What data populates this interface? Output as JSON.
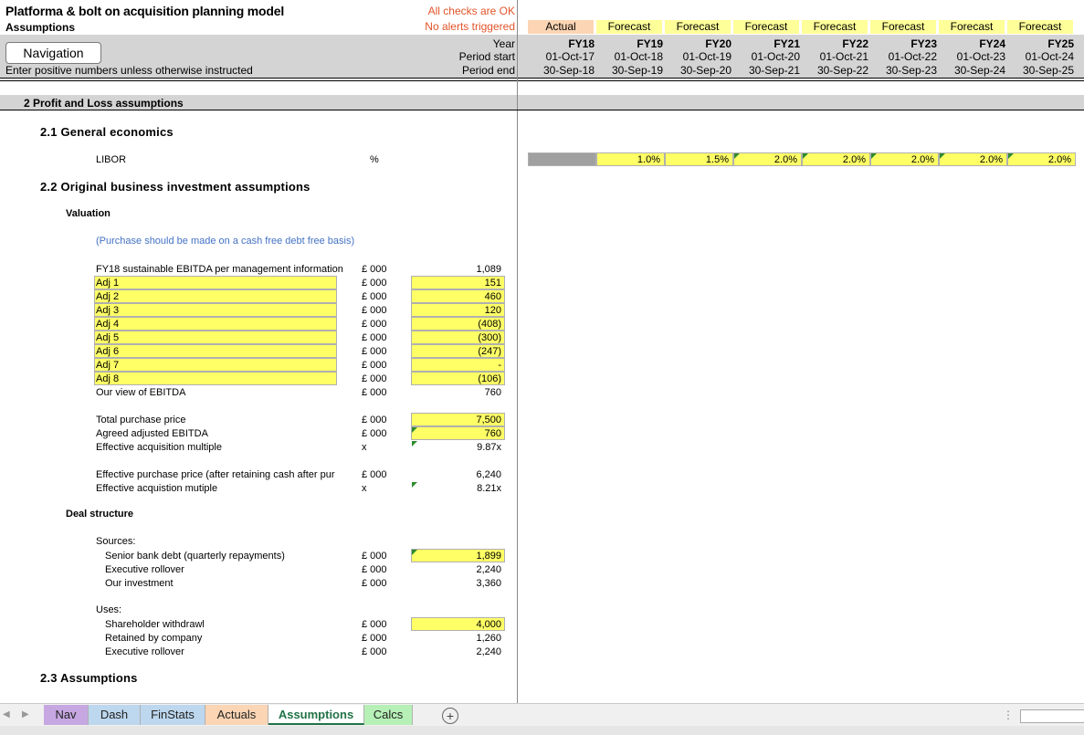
{
  "header": {
    "title": "Platforma & bolt on acquisition planning model",
    "subtitle": "Assumptions",
    "checks_ok": "All checks are OK",
    "alerts": "No alerts triggered",
    "nav_button": "Navigation",
    "instruction": "Enter positive numbers unless otherwise instructed",
    "row_year": "Year",
    "row_period_start": "Period start",
    "row_period_end": "Period end"
  },
  "columns": [
    {
      "type": "Actual",
      "year": "FY18",
      "start": "01-Oct-17",
      "end": "30-Sep-18"
    },
    {
      "type": "Forecast",
      "year": "FY19",
      "start": "01-Oct-18",
      "end": "30-Sep-19"
    },
    {
      "type": "Forecast",
      "year": "FY20",
      "start": "01-Oct-19",
      "end": "30-Sep-20"
    },
    {
      "type": "Forecast",
      "year": "FY21",
      "start": "01-Oct-20",
      "end": "30-Sep-21"
    },
    {
      "type": "Forecast",
      "year": "FY22",
      "start": "01-Oct-21",
      "end": "30-Sep-22"
    },
    {
      "type": "Forecast",
      "year": "FY23",
      "start": "01-Oct-22",
      "end": "30-Sep-23"
    },
    {
      "type": "Forecast",
      "year": "FY24",
      "start": "01-Oct-23",
      "end": "30-Sep-24"
    },
    {
      "type": "Forecast",
      "year": "FY25",
      "start": "01-Oct-24",
      "end": "30-Sep-25"
    }
  ],
  "sections": {
    "s2": "2 Profit and Loss assumptions",
    "s21": "2.1  General economics",
    "s22": "2.2  Original business investment assumptions",
    "s23": "2.3  Assumptions",
    "valuation": "Valuation",
    "deal": "Deal structure"
  },
  "libor": {
    "label": "LIBOR",
    "unit": "%",
    "values": [
      "",
      "1.0%",
      "1.5%",
      "2.0%",
      "2.0%",
      "2.0%",
      "2.0%",
      "2.0%"
    ]
  },
  "valuation_note": "(Purchase should be made on a cash free debt free basis)",
  "ebitda_rows": [
    {
      "label": "FY18 sustainable EBITDA per management information",
      "unit": "£ 000",
      "value": "1,089"
    },
    {
      "label": "Adj 1",
      "unit": "£ 000",
      "value": "151"
    },
    {
      "label": "Adj 2",
      "unit": "£ 000",
      "value": "460"
    },
    {
      "label": "Adj 3",
      "unit": "£ 000",
      "value": "120"
    },
    {
      "label": "Adj 4",
      "unit": "£ 000",
      "value": "(408)"
    },
    {
      "label": "Adj 5",
      "unit": "£ 000",
      "value": "(300)"
    },
    {
      "label": "Adj 6",
      "unit": "£ 000",
      "value": "(247)"
    },
    {
      "label": "Adj 7",
      "unit": "£ 000",
      "value": "-"
    },
    {
      "label": "Adj 8",
      "unit": "£ 000",
      "value": "(106)"
    },
    {
      "label": "Our view of EBITDA",
      "unit": "£ 000",
      "value": "760"
    }
  ],
  "price_rows": [
    {
      "label": "Total purchase price",
      "unit": "£ 000",
      "value": "7,500"
    },
    {
      "label": "Agreed adjusted EBITDA",
      "unit": "£ 000",
      "value": "760"
    },
    {
      "label": "Effective acquisition multiple",
      "unit": "x",
      "value": "9.87x"
    }
  ],
  "effective_rows": [
    {
      "label": "Effective purchase price (after retaining cash after pur",
      "unit": "£ 000",
      "value": "6,240"
    },
    {
      "label": "Effective acquistion mutiple",
      "unit": "x",
      "value": "8.21x"
    }
  ],
  "sources": {
    "heading": "Sources:",
    "rows": [
      {
        "label": "Senior bank debt (quarterly repayments)",
        "unit": "£ 000",
        "value": "1,899"
      },
      {
        "label": "Executive rollover",
        "unit": "£ 000",
        "value": "2,240"
      },
      {
        "label": "Our investment",
        "unit": "£ 000",
        "value": "3,360"
      }
    ]
  },
  "uses": {
    "heading": "Uses:",
    "rows": [
      {
        "label": "Shareholder withdrawl",
        "unit": "£ 000",
        "value": "4,000"
      },
      {
        "label": "Retained by company",
        "unit": "£ 000",
        "value": "1,260"
      },
      {
        "label": "Executive rollover",
        "unit": "£ 000",
        "value": "2,240"
      }
    ]
  },
  "tabs": [
    "Nav",
    "Dash",
    "FinStats",
    "Actuals",
    "Assumptions",
    "Calcs"
  ],
  "colors": {
    "actual_hdr": "#fcd5b4",
    "forecast_hdr": "#ffff99",
    "input": "#ffff66",
    "tab_nav": "#c6a7e2",
    "tab_dash": "#bdd7ee",
    "tab_finstats": "#bdd7ee",
    "tab_actuals": "#fcd5b4",
    "tab_calcs": "#b6f0b6",
    "alert": "#e2542a"
  }
}
